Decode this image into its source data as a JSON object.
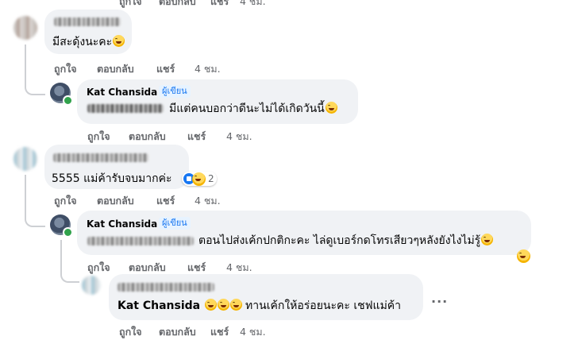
{
  "actions": {
    "like": "ถูกใจ",
    "reply": "ตอบกลับ",
    "share": "แชร์",
    "time": "4 ชม."
  },
  "comments": [
    {
      "text": "มีสะดุ้งนะคะ"
    },
    {
      "author": "Kat Chansida",
      "badge": "ผู้เขียน",
      "text": "มีแต่คนบอกว่าดีนะไม่ได้เกิดวันนี้"
    },
    {
      "text": "5555 แม่ค้ารับจบมากค่ะ",
      "reaction_count": "2"
    },
    {
      "author": "Kat Chansida",
      "badge": "ผู้เขียน",
      "text": "ตอนไปส่งเค้กปกติกะคะ ไล่ดูเบอร์กดโทรเสียวๆหลังยังไงไม่รู้"
    },
    {
      "mention": "Kat Chansida",
      "text": "ทานเค้กให้อร่อยนะคะ เชฟแม่ค้า"
    }
  ],
  "more": "..."
}
